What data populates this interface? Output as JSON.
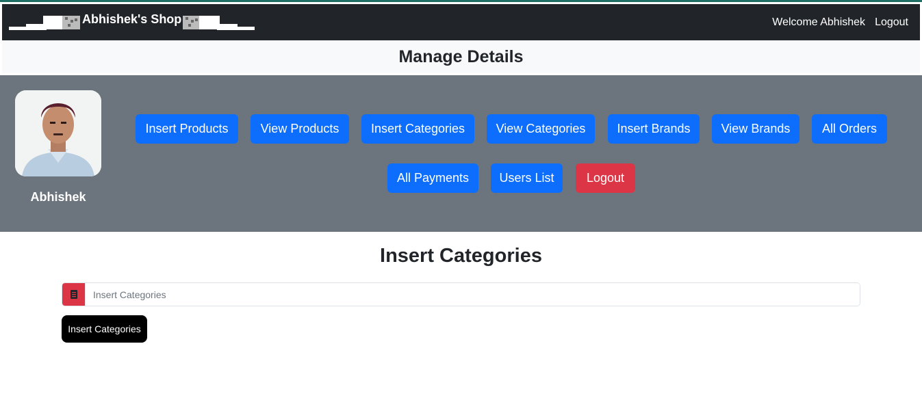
{
  "navbar": {
    "brand": "Abhishek's Shop",
    "welcome": "Welcome Abhishek",
    "logout": "Logout"
  },
  "page_title": "Manage Details",
  "admin": {
    "name": "Abhishek"
  },
  "buttons": {
    "insert_products": "Insert Products",
    "view_products": "View Products",
    "insert_categories": "Insert Categories",
    "view_categories": "View Categories",
    "insert_brands": "Insert Brands",
    "view_brands": "View Brands",
    "all_orders": "All Orders",
    "all_payments": "All Payments",
    "users_list": "Users List",
    "logout": "Logout"
  },
  "form": {
    "title": "Insert Categories",
    "placeholder": "Insert Categories",
    "submit": "Insert Categories"
  },
  "colors": {
    "navbar": "#212529",
    "panel": "#6c757d",
    "primary": "#0d6efd",
    "danger": "#dc3545",
    "submit": "#000000"
  },
  "icons": {
    "input_icon": "receipt-icon"
  }
}
